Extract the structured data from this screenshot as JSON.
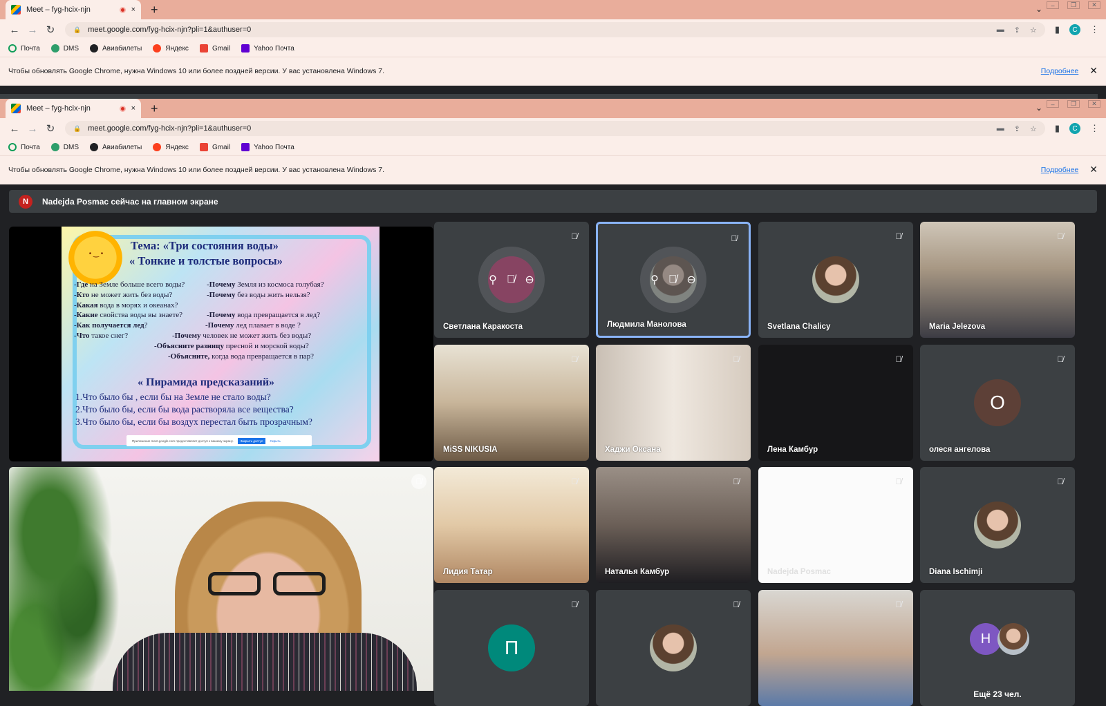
{
  "browser": {
    "tab_title": "Meet – fyg-hcix-njn",
    "tab_close": "×",
    "new_tab": "+",
    "url": "meet.google.com/fyg-hcix-njn?pli=1&authuser=0",
    "profile_initial": "C",
    "bookmarks": [
      "Почта",
      "DMS",
      "Авиабилеты",
      "Яндекс",
      "Gmail",
      "Yahoo Почта"
    ],
    "infobar_message": "Чтобы обновлять Google Chrome, нужна Windows 10 или более поздней версии. У вас установлена Windows 7.",
    "infobar_link": "Подробнее",
    "infobar_close": "✕"
  },
  "meet": {
    "banner_initial": "N",
    "banner_text": "Nadejda Posmac сейчас на главном экране",
    "slide": {
      "title_1": "Тема:   «Три состояния воды»",
      "title_2": "« Тонкие и толстые вопросы»",
      "left_q": [
        {
          "b": "-Где",
          "t": " на Земле больше всего воды?"
        },
        {
          "b": "-Кто",
          "t": " не может жить без воды?"
        },
        {
          "b": "-Какая",
          "t": " вода в морях и океанах?"
        },
        {
          "b": "-Какие",
          "t": " свойства воды вы знаете?"
        },
        {
          "b": " -Как получается лед",
          "t": "?"
        },
        {
          "b": "-Что",
          "t": " такое снег?"
        }
      ],
      "right_q": [
        {
          "b": "-Почему",
          "t": " Земля из космоса голубая?"
        },
        {
          "b": "-Почему",
          "t": " без воды жить нельзя?"
        },
        {
          "b": "",
          "t": ""
        },
        {
          "b": "-Почему",
          "t": " вода превращается в лед?"
        },
        {
          "b": "-Почему",
          "t": " лед плавает в воде ?"
        },
        {
          "b": "-Почему",
          "t": " человек не может  жить без воды?"
        },
        {
          "b": "-Объясните разницу",
          "t": " пресной и   морской воды?"
        },
        {
          "b": "-Объясните,",
          "t": " когда вода превращается в пар?"
        }
      ],
      "pyramid_title": "« Пирамида предсказаний»",
      "pyramid": [
        "1.Что было бы , если бы на Земле не стало воды?",
        "2.Что было бы, если бы вода растворяла все вещества?",
        "3.Что было бы, если бы воздух перестал быть прозрачным?"
      ],
      "notice_text": "Приложение meet.google.com предоставляет доступ к вашему экрану.",
      "notice_button": "Закрыть доступ",
      "notice_link": "Скрыть"
    },
    "tiles": [
      {
        "name": "Светлана Каракоста",
        "kind": "avatar-hover",
        "color": "#c2185b"
      },
      {
        "name": "Людмила Манолова",
        "kind": "photo-hover",
        "active": true
      },
      {
        "name": "Svetlana Chalicy",
        "kind": "photo-avatar"
      },
      {
        "name": "Maria Jelezova",
        "kind": "video"
      },
      {
        "name": "MiSS NIKUSIA",
        "kind": "video"
      },
      {
        "name": "Хаджи Оксана",
        "kind": "video"
      },
      {
        "name": "Лена Камбур",
        "kind": "dark"
      },
      {
        "name": "олеся ангелова",
        "kind": "letter",
        "letter": "О",
        "color": "#5d4037"
      },
      {
        "name": "Лидия Татар",
        "kind": "video"
      },
      {
        "name": "Наталья Камбур",
        "kind": "video"
      },
      {
        "name": "Nadejda Posmac",
        "kind": "white"
      },
      {
        "name": "Diana Ischimji",
        "kind": "photo-avatar"
      },
      {
        "name": "",
        "kind": "letter",
        "letter": "П",
        "color": "#00897b"
      },
      {
        "name": "",
        "kind": "photo-avatar"
      },
      {
        "name": "",
        "kind": "video"
      }
    ],
    "more_tile": {
      "letter": "Н",
      "color": "#7e57c2",
      "text": "Ещё 23 чел."
    }
  }
}
